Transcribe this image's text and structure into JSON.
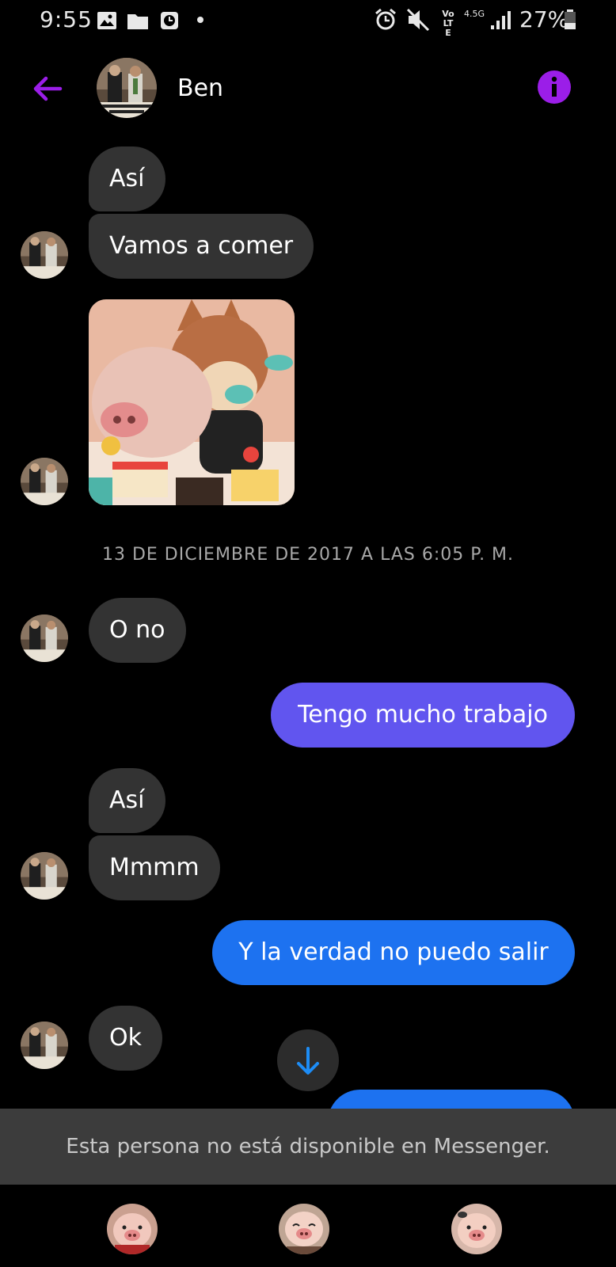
{
  "status_bar": {
    "time": "9:55",
    "battery_percent": "27%",
    "volte": "Vo LTE",
    "network": "4.5G"
  },
  "header": {
    "contact_name": "Ben"
  },
  "messages": [
    {
      "text": "Así",
      "direction": "incoming"
    },
    {
      "text": "Vamos a comer",
      "direction": "incoming"
    },
    {
      "text": "",
      "direction": "incoming",
      "type": "sticker"
    },
    {
      "text": "O no",
      "direction": "incoming"
    },
    {
      "text": "Tengo mucho trabajo",
      "direction": "outgoing"
    },
    {
      "text": "Así",
      "direction": "incoming"
    },
    {
      "text": "Mmmm",
      "direction": "incoming"
    },
    {
      "text": "Y la verdad no puedo salir",
      "direction": "outgoing"
    },
    {
      "text": "Ok",
      "direction": "incoming"
    }
  ],
  "timestamp": "13 DE DICIEMBRE DE 2017 A LAS 6:05 P. M.",
  "banner": {
    "text": "Esta persona no está disponible en Messenger."
  },
  "colors": {
    "accent_purple": "#9b1ee8",
    "bubble_incoming": "#333333",
    "bubble_outgoing_purple": "#6155ef",
    "bubble_outgoing_blue": "#1d72f0",
    "banner_bg": "#3c3c3c"
  },
  "icons": {
    "back": "arrow-left-icon",
    "info": "info-icon",
    "scroll_down": "arrow-down-icon"
  }
}
